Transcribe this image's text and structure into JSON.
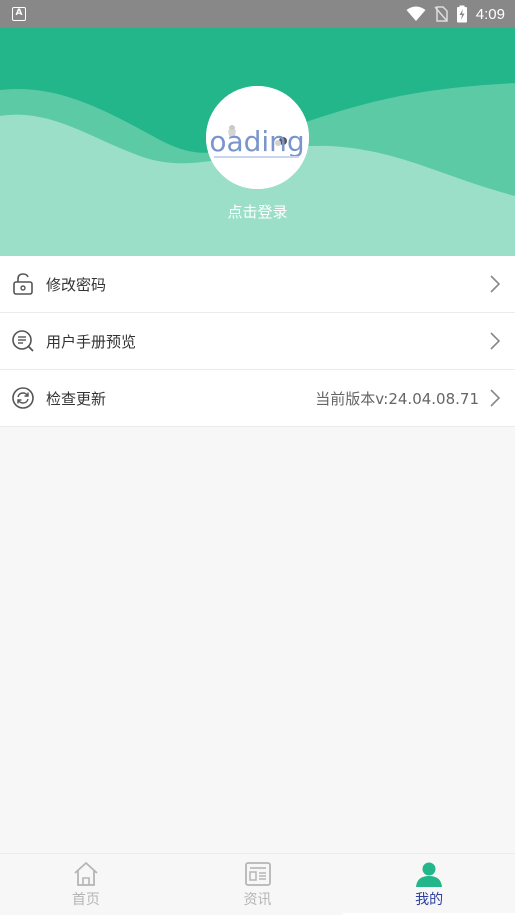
{
  "status_bar": {
    "left_icon": "A",
    "time": "4:09"
  },
  "header": {
    "avatar_text": "oading",
    "login_text": "点击登录",
    "colors": {
      "primary": "#23b68a",
      "wave_light": "#9bdfc8",
      "wave_mid": "#6fd0ae"
    }
  },
  "menu": {
    "items": [
      {
        "icon": "lock-icon",
        "label": "修改密码",
        "extra": ""
      },
      {
        "icon": "manual-search-icon",
        "label": "用户手册预览",
        "extra": ""
      },
      {
        "icon": "refresh-icon",
        "label": "检查更新",
        "extra": "当前版本v:24.04.08.71"
      }
    ]
  },
  "tabbar": {
    "tabs": [
      {
        "icon": "home-icon",
        "label": "首页",
        "active": false
      },
      {
        "icon": "news-icon",
        "label": "资讯",
        "active": false
      },
      {
        "icon": "user-icon",
        "label": "我的",
        "active": true
      }
    ]
  }
}
